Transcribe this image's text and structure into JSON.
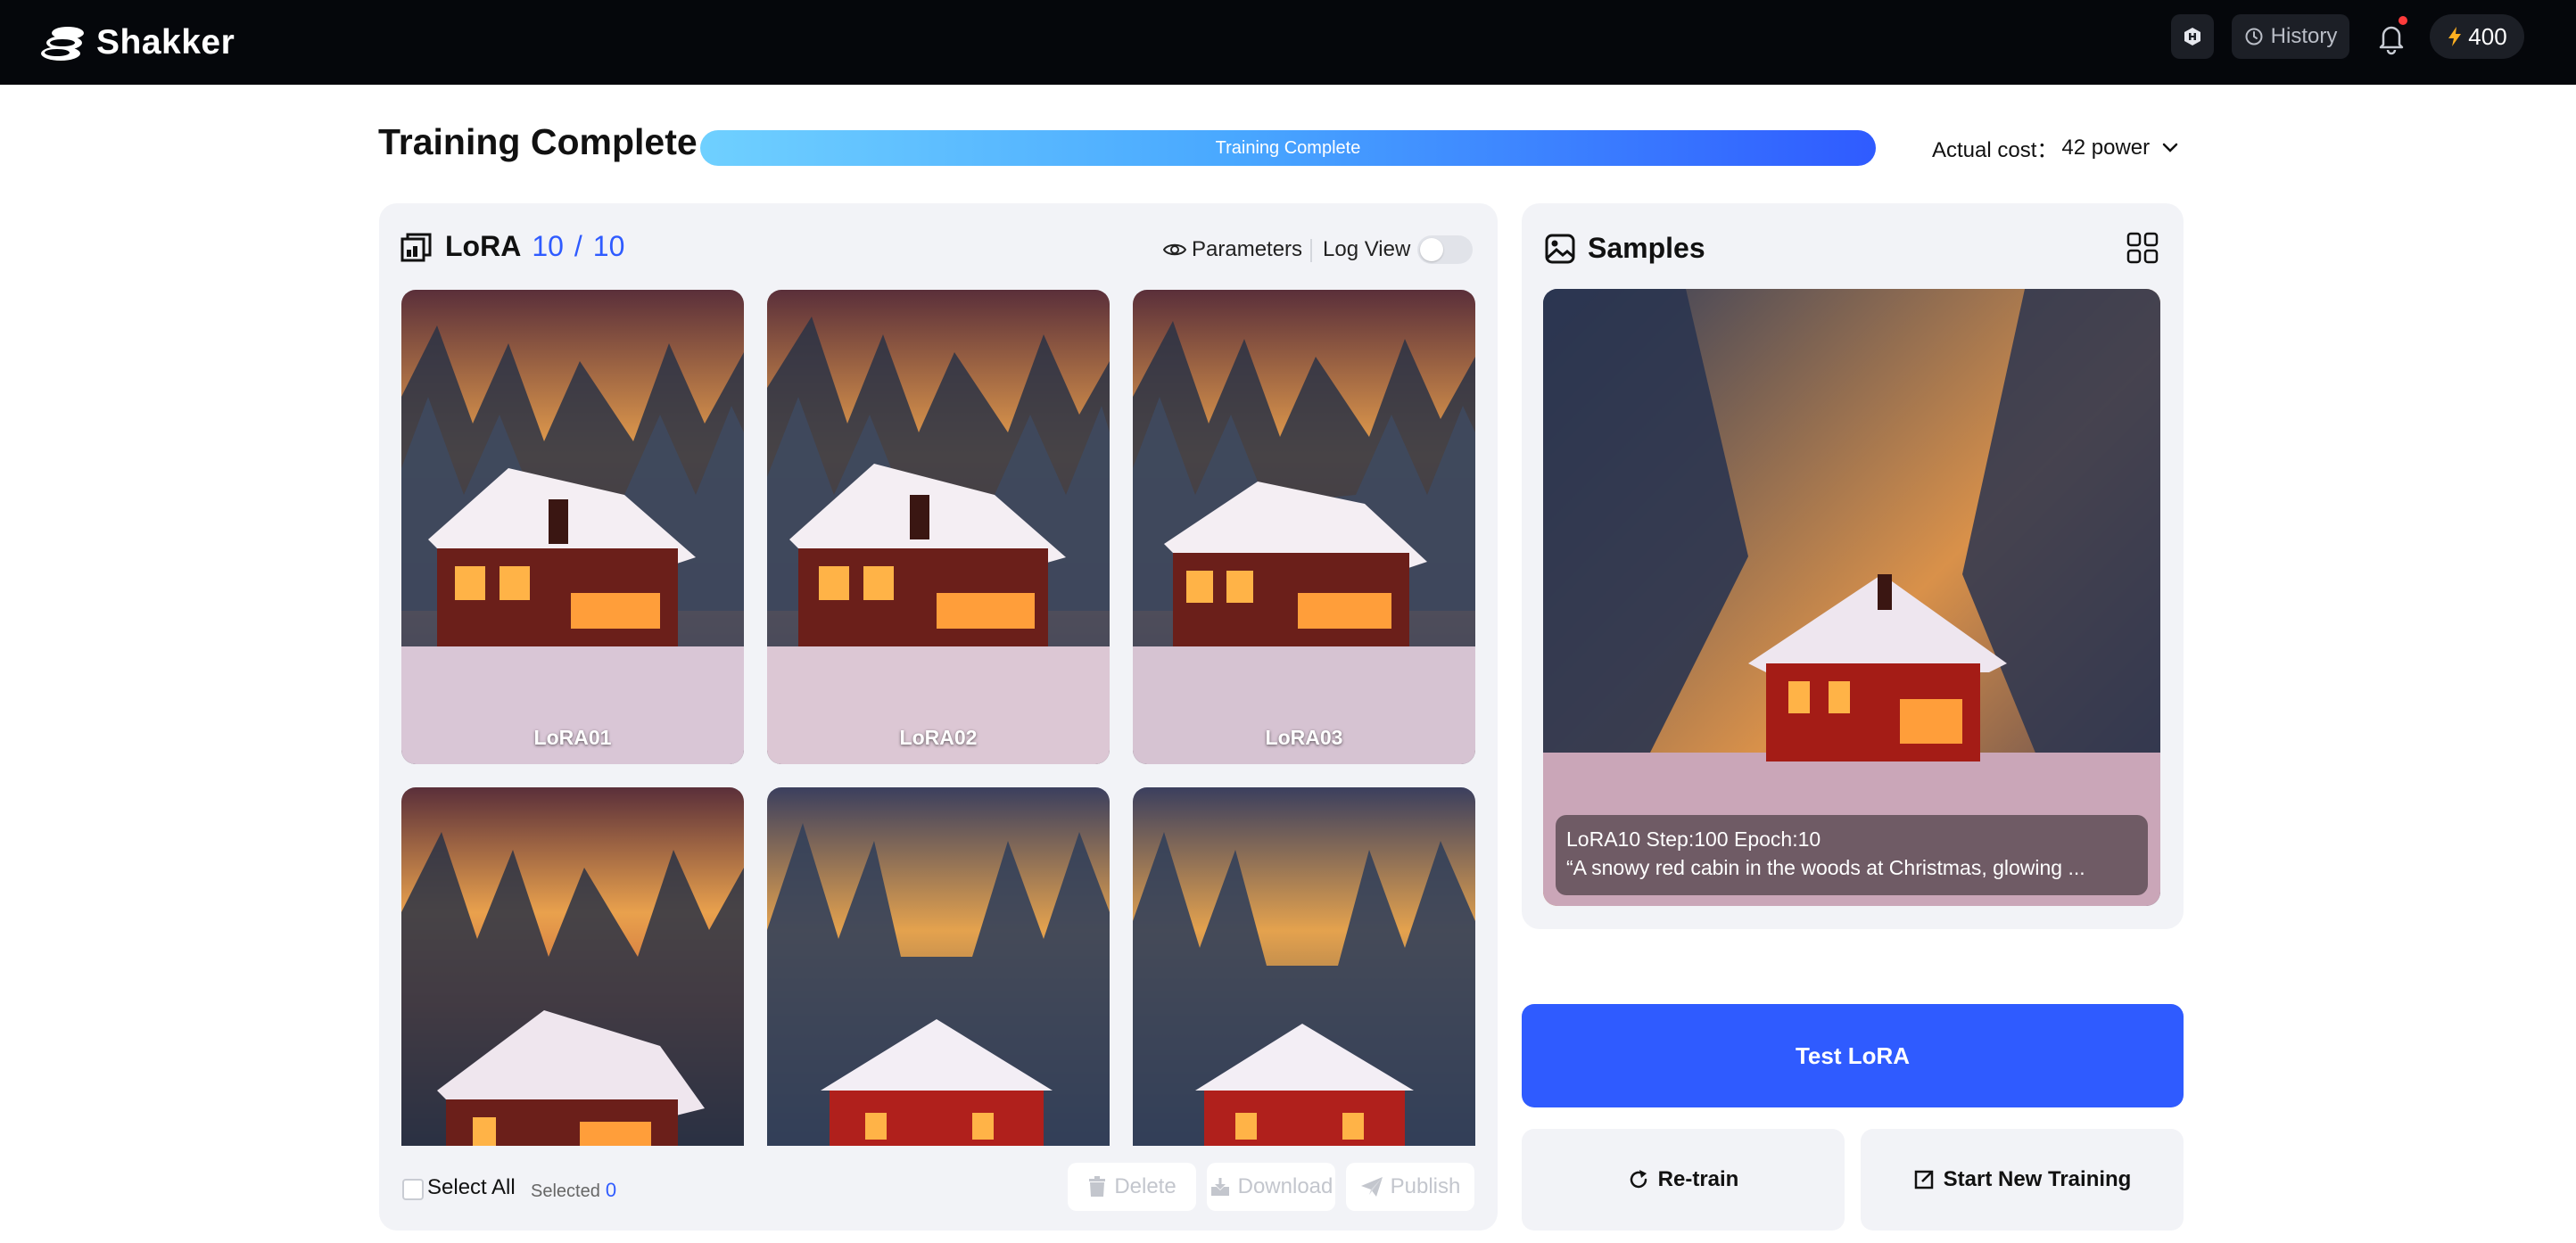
{
  "topbar": {
    "brand": "Shakker",
    "history_label": "History",
    "power_balance": "400",
    "notification_dot": true
  },
  "header": {
    "title": "Training Complete",
    "progress_label": "Training Complete",
    "progress_fraction": 1.0,
    "cost_label": "Actual cost：",
    "cost_value": "42 power"
  },
  "lora_panel": {
    "title": "LoRA",
    "count_done": "10",
    "count_total": "10",
    "parameters_label": "Parameters",
    "log_view_label": "Log View",
    "log_view_on": false,
    "items": [
      {
        "label": "LoRA01"
      },
      {
        "label": "LoRA02"
      },
      {
        "label": "LoRA03"
      },
      {
        "label": ""
      },
      {
        "label": ""
      },
      {
        "label": ""
      }
    ],
    "select_all_label": "Select All",
    "selected_label": "Selected",
    "selected_count": "0",
    "delete_label": "Delete",
    "download_label": "Download",
    "publish_label": "Publish"
  },
  "samples_panel": {
    "title": "Samples",
    "caption_line1": "LoRA10 Step:100 Epoch:10",
    "caption_line2": "“A snowy red cabin in the woods at Christmas,  glowing ..."
  },
  "actions": {
    "test_label": "Test LoRA",
    "retrain_label": "Re-train",
    "new_training_label": "Start New Training"
  },
  "colors": {
    "accent": "#2f5bff",
    "topbar_bg": "#05070b",
    "panel_bg": "#f2f3f7"
  }
}
